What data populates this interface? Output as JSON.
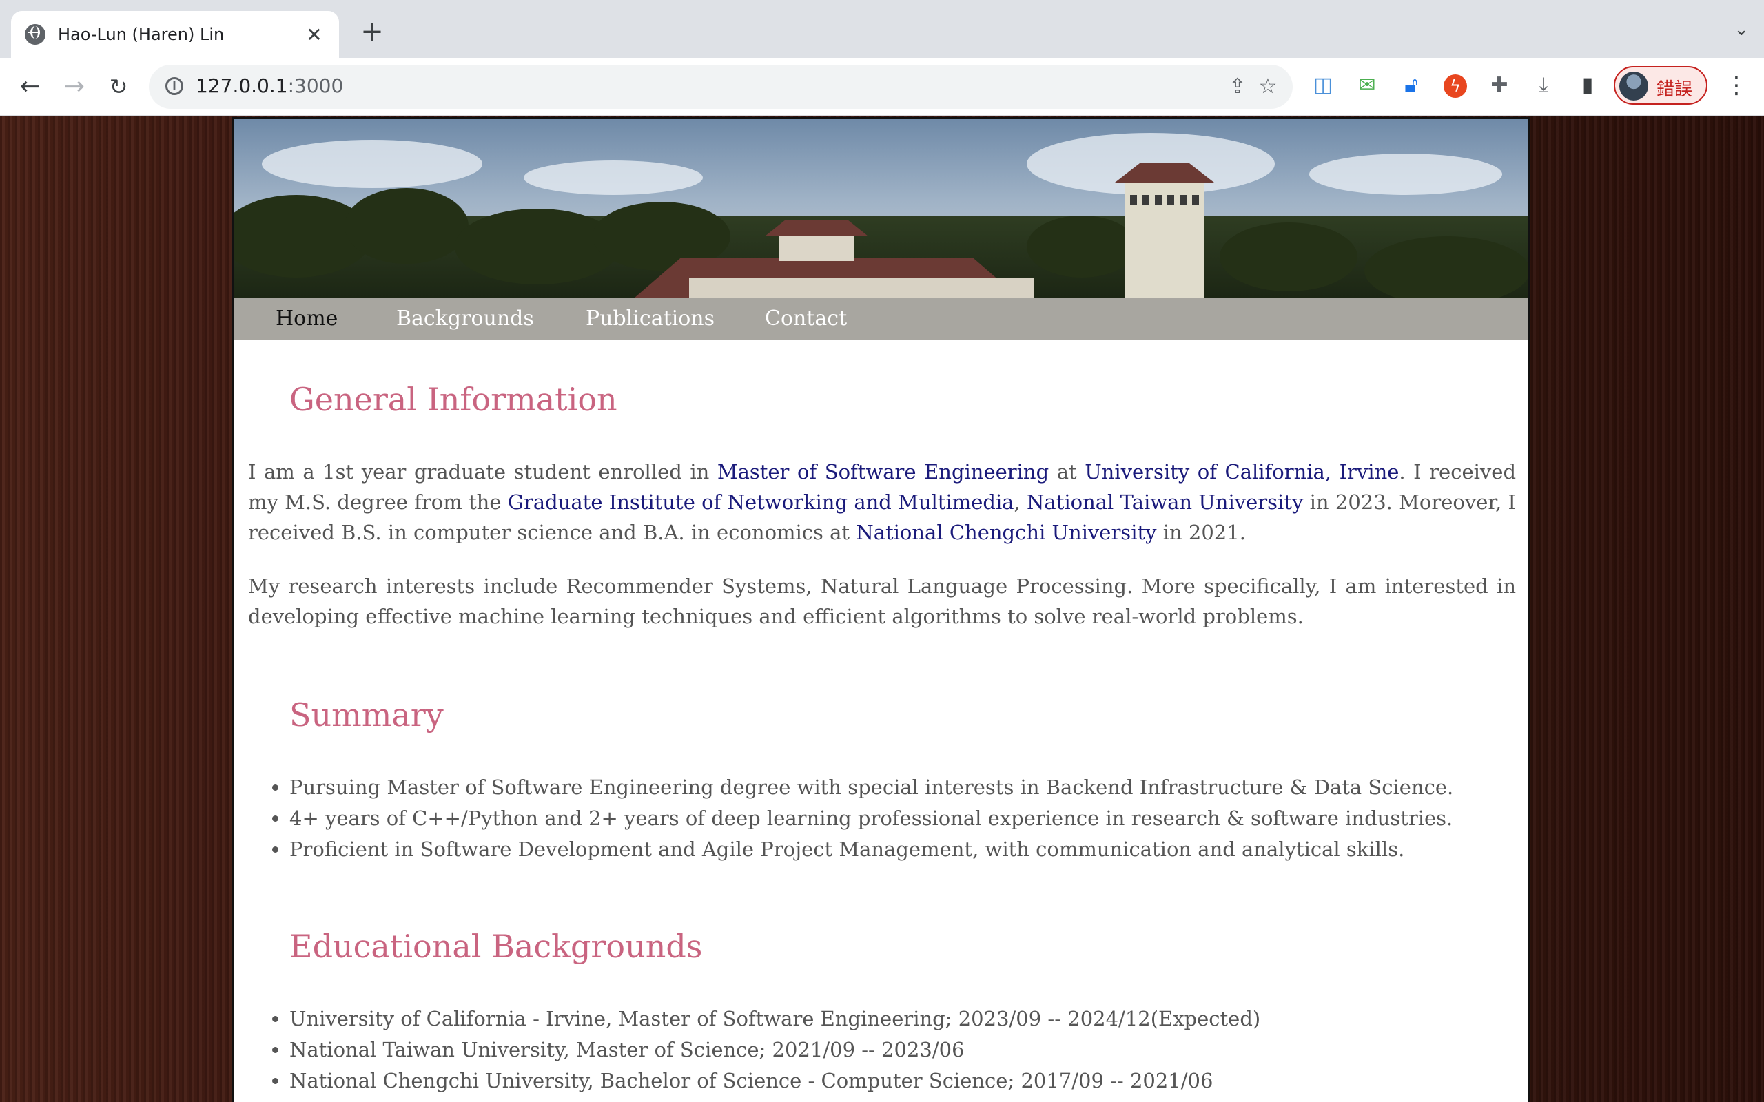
{
  "browser": {
    "tab_title": "Hao-Lun (Haren) Lin",
    "url_host": "127.0.0.1",
    "url_port": ":3000",
    "profile_label": "錯誤"
  },
  "nav": {
    "items": [
      "Home",
      "Backgrounds",
      "Publications",
      "Contact"
    ],
    "active": "Home"
  },
  "general": {
    "heading": "General Information",
    "p1": {
      "t1": "I am a 1st year graduate student enrolled in ",
      "l1": "Master of Software Engineering",
      "t2": " at ",
      "l2": "University of California, Irvine",
      "t3": ". I received my M.S. degree from the ",
      "l3": "Graduate Institute of Networking and Multimedia",
      "t4": ", ",
      "l4": "National Taiwan University",
      "t5": " in 2023. Moreover, I received B.S. in computer science and B.A. in economics at ",
      "l5": "National Chengchi University",
      "t6": " in 2021."
    },
    "p2": "My research interests include Recommender Systems, Natural Language Processing. More specifically, I am interested in developing effective machine learning techniques and efficient algorithms to solve real-world problems."
  },
  "summary": {
    "heading": "Summary",
    "items": [
      "Pursuing Master of Software Engineering degree with special interests in Backend Infrastructure & Data Science.",
      "4+ years of C++/Python and 2+ years of deep learning professional experience in research & software industries.",
      "Proficient in Software Development and Agile Project Management, with communication and analytical skills."
    ]
  },
  "education": {
    "heading": "Educational Backgrounds",
    "items": [
      "University of California - Irvine, Master of Software Engineering; 2023/09 -- 2024/12(Expected)",
      "National Taiwan University, Master of Science; 2021/09 -- 2023/06",
      "National Chengchi University, Bachelor of Science - Computer Science; 2017/09 -- 2021/06"
    ]
  }
}
